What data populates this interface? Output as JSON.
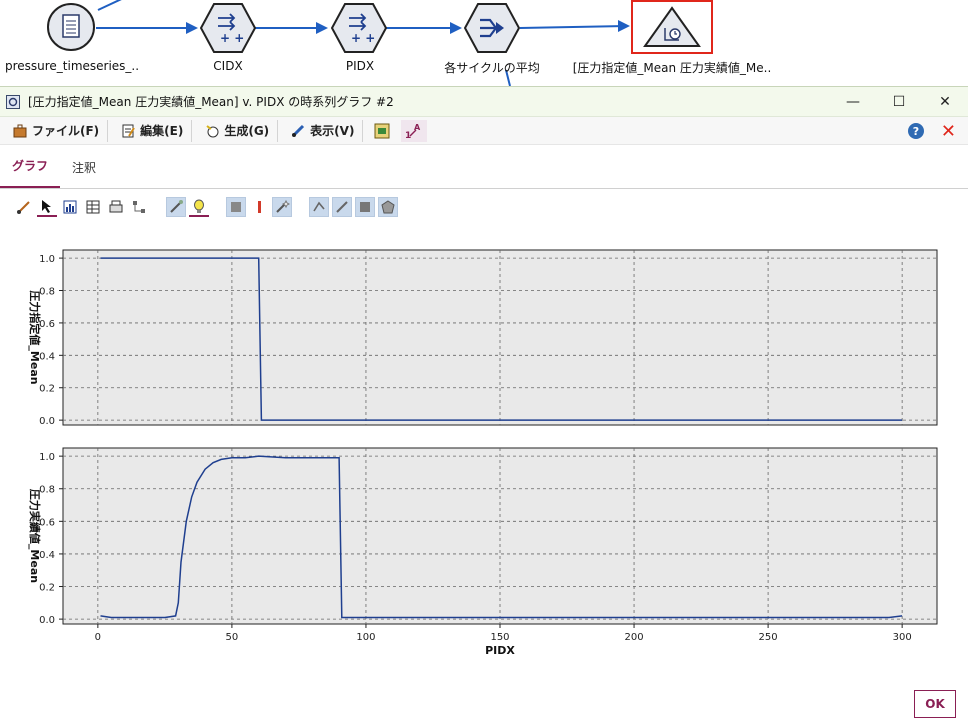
{
  "stream": {
    "nodes": [
      {
        "label": "pressure_timeseries_..",
        "icon": "data-file-icon"
      },
      {
        "label": "CIDX",
        "icon": "derive-icon"
      },
      {
        "label": "PIDX",
        "icon": "derive-icon"
      },
      {
        "label": "各サイクルの平均",
        "icon": "aggregate-icon"
      },
      {
        "label": "[圧力指定値_Mean 圧力実績値_Me..",
        "icon": "time-plot-icon"
      }
    ]
  },
  "dialog": {
    "title": "[圧力指定値_Mean 圧力実績値_Mean] v. PIDX の時系列グラフ #2",
    "window_buttons": {
      "minimize": "—",
      "maximize": "☐",
      "close": "✕"
    },
    "menu": [
      {
        "label": "ファイル(F)",
        "icon": "briefcase-icon"
      },
      {
        "label": "編集(E)",
        "icon": "edit-icon"
      },
      {
        "label": "生成(G)",
        "icon": "generate-icon"
      },
      {
        "label": "表示(V)",
        "icon": "view-icon"
      }
    ],
    "help": "?",
    "tabs": [
      "グラフ",
      "注釈"
    ],
    "ok_label": "OK"
  },
  "colors": {
    "accent": "#8a1f54",
    "line": "#1f3f8f",
    "plot_bg": "#e9e9e9",
    "close_red": "#e0261b"
  },
  "chart_data": [
    {
      "type": "line",
      "ylabel": "圧力指定値_Mean",
      "xlabel": "",
      "xlim": [
        -13,
        313
      ],
      "ylim": [
        -0.03,
        1.05
      ],
      "yticks": [
        "0.0",
        "0.2",
        "0.4",
        "0.6",
        "0.8",
        "1.0"
      ],
      "series": [
        {
          "x": [
            1,
            60,
            61,
            300
          ],
          "y": [
            1.0,
            1.0,
            0.0,
            0.0
          ]
        }
      ],
      "grid": true
    },
    {
      "type": "line",
      "ylabel": "圧力実績値_Mean",
      "xlabel": "PIDX",
      "xlim": [
        -13,
        313
      ],
      "ylim": [
        -0.03,
        1.05
      ],
      "yticks": [
        "0.0",
        "0.2",
        "0.4",
        "0.6",
        "0.8",
        "1.0"
      ],
      "xticks": [
        "0",
        "50",
        "100",
        "150",
        "200",
        "250",
        "300"
      ],
      "series": [
        {
          "x": [
            1,
            5,
            10,
            15,
            20,
            25,
            29,
            30,
            31,
            33,
            35,
            37,
            40,
            43,
            46,
            50,
            55,
            60,
            70,
            80,
            89,
            90,
            91,
            100,
            150,
            200,
            250,
            295,
            300
          ],
          "y": [
            0.02,
            0.01,
            0.01,
            0.01,
            0.01,
            0.01,
            0.02,
            0.1,
            0.35,
            0.6,
            0.75,
            0.84,
            0.92,
            0.96,
            0.98,
            0.99,
            0.99,
            1.0,
            0.99,
            0.99,
            0.99,
            0.99,
            0.01,
            0.01,
            0.01,
            0.01,
            0.01,
            0.01,
            0.02
          ]
        }
      ],
      "grid": true
    }
  ]
}
